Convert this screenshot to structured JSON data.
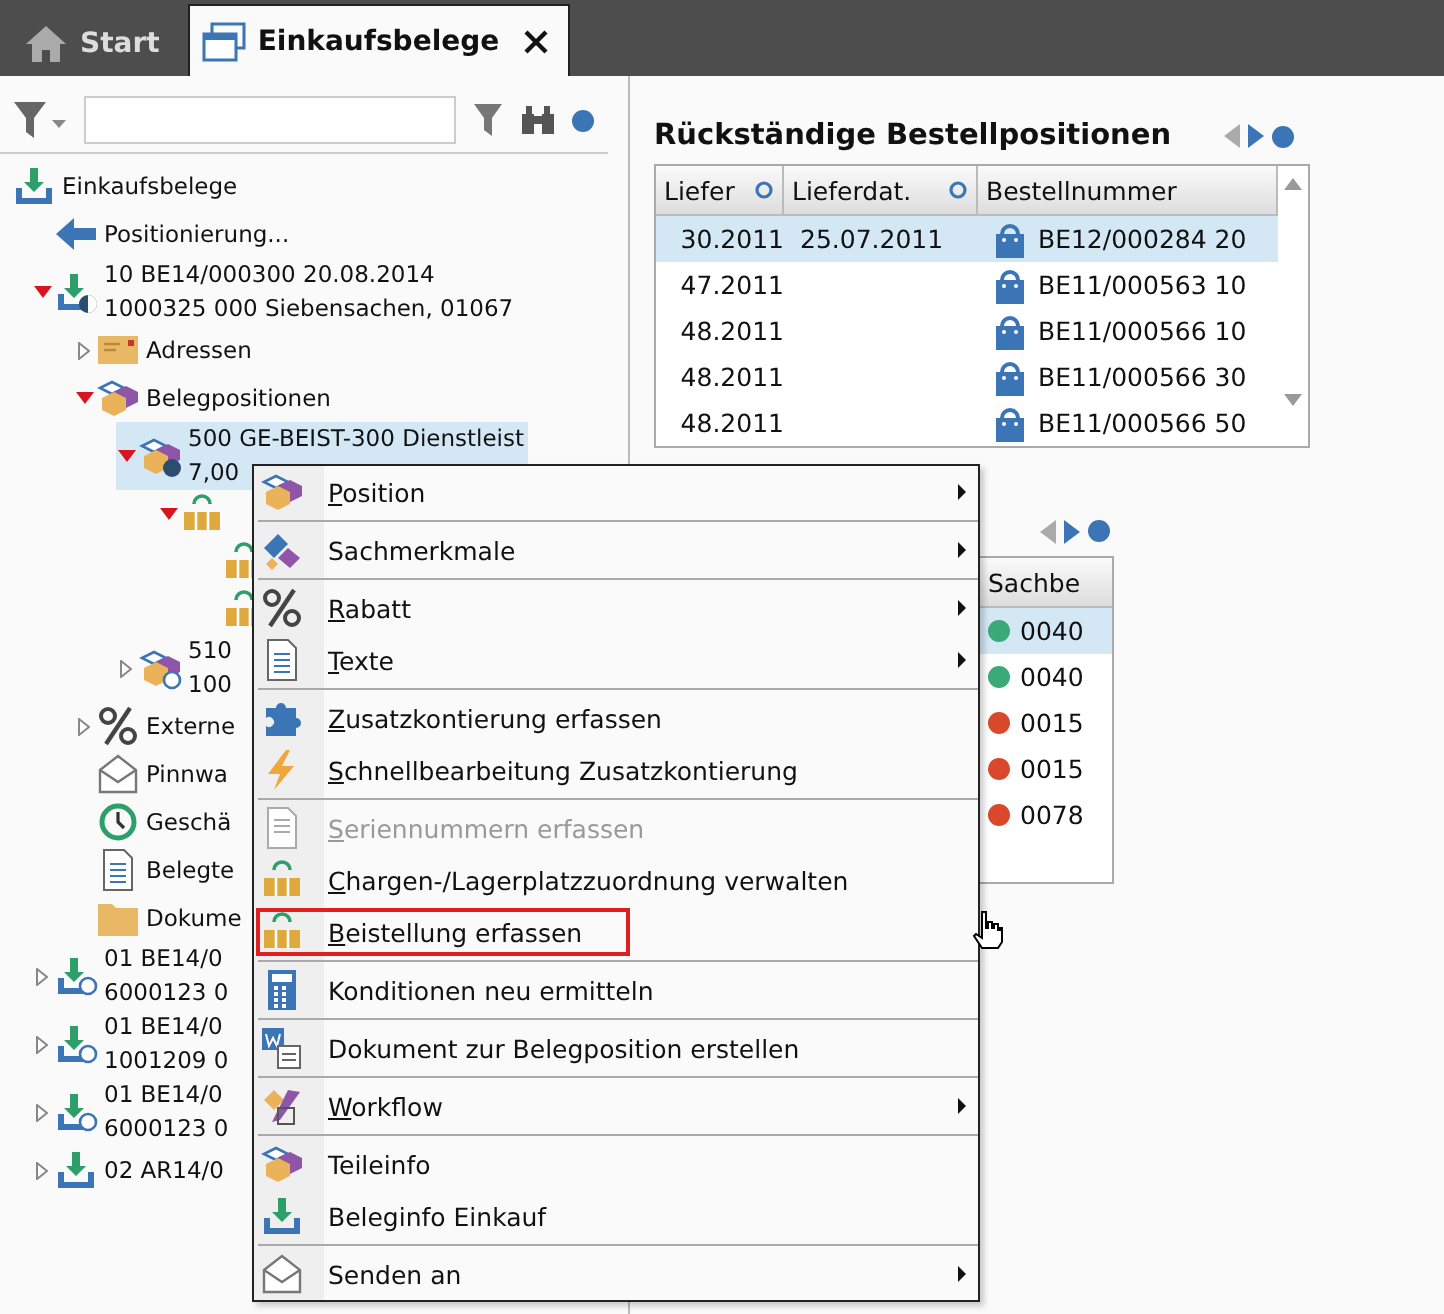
{
  "tabs": [
    {
      "label": "Start",
      "kind": "home",
      "selected": false,
      "closable": false
    },
    {
      "label": "Einkaufsbelege",
      "kind": "window",
      "selected": true,
      "closable": true
    }
  ],
  "tree": [
    {
      "kind": "inbox",
      "lines": [
        "Einkaufsbelege"
      ],
      "children": [
        {
          "kind": "arrow",
          "lines": [
            "Positionierung..."
          ]
        },
        {
          "kind": "inbox-half",
          "expanded": true,
          "lines": [
            "10 BE14/000300 20.08.2014",
            "1000325 000 Siebensachen, 01067"
          ],
          "children": [
            {
              "kind": "address",
              "expanded": false,
              "lines": [
                "Adressen"
              ]
            },
            {
              "kind": "boxes",
              "expanded": true,
              "lines": [
                "Belegpositionen"
              ],
              "children": [
                {
                  "kind": "boxes-dark",
                  "expanded": true,
                  "selected": true,
                  "lines": [
                    "500 GE-BEIST-300 Dienstleist",
                    "7,00"
                  ],
                  "children": [
                    {
                      "kind": "supply",
                      "expanded": true,
                      "children": [
                        {
                          "kind": "supply"
                        },
                        {
                          "kind": "supply"
                        }
                      ]
                    }
                  ]
                },
                {
                  "kind": "boxes-ring",
                  "expanded": false,
                  "selected": false,
                  "lines": [
                    "510",
                    "100"
                  ]
                }
              ]
            },
            {
              "kind": "percent",
              "expanded": false,
              "lines": [
                "Externe"
              ]
            },
            {
              "kind": "mail",
              "lines": [
                "Pinnwa"
              ]
            },
            {
              "kind": "history",
              "lines": [
                "Geschä"
              ]
            },
            {
              "kind": "text",
              "lines": [
                "Belegte"
              ]
            },
            {
              "kind": "folder",
              "lines": [
                "Dokume"
              ]
            }
          ]
        },
        {
          "kind": "inbox-ring",
          "expanded": false,
          "lines": [
            "01 BE14/0",
            "6000123 0"
          ]
        },
        {
          "kind": "inbox-ring",
          "expanded": false,
          "lines": [
            "01 BE14/0",
            "1001209 0"
          ]
        },
        {
          "kind": "inbox-ring",
          "expanded": false,
          "lines": [
            "01 BE14/0",
            "6000123 0"
          ]
        },
        {
          "kind": "inbox",
          "expanded": false,
          "lines": [
            "02 AR14/0"
          ]
        }
      ]
    }
  ],
  "backlog": {
    "title": "Rückständige Bestellpositionen",
    "columns": [
      "Liefer",
      "Lieferdat.",
      "Bestellnummer"
    ],
    "rows": [
      {
        "selected": true,
        "cells": [
          "30.2011",
          "25.07.2011",
          "BE12/000284 20"
        ]
      },
      {
        "selected": false,
        "cells": [
          "47.2011",
          "",
          "BE11/000563 10"
        ]
      },
      {
        "selected": false,
        "cells": [
          "48.2011",
          "",
          "BE11/000566 10"
        ]
      },
      {
        "selected": false,
        "cells": [
          "48.2011",
          "",
          "BE11/000566 30"
        ]
      },
      {
        "selected": false,
        "cells": [
          "48.2011",
          "",
          "BE11/000566 50"
        ]
      }
    ]
  },
  "second_panel": {
    "columns": [
      "Sachbe"
    ],
    "rows": [
      {
        "selected": true,
        "color": "#3aaa78",
        "value": "0040"
      },
      {
        "selected": false,
        "color": "#3aaa78",
        "value": "0040"
      },
      {
        "selected": false,
        "color": "#d9482b",
        "value": "0015"
      },
      {
        "selected": false,
        "color": "#d9482b",
        "value": "0015"
      },
      {
        "selected": false,
        "color": "#d9482b",
        "value": "0078"
      }
    ]
  },
  "context_menu": [
    {
      "kind": "boxes",
      "label": "Position",
      "mnemonic": true,
      "submenu": true,
      "disabled": false,
      "selected": false,
      "separator_before": false
    },
    {
      "kind": "tag",
      "label": "Sachmerkmale",
      "mnemonic": false,
      "submenu": true,
      "disabled": false,
      "selected": false,
      "separator_before": true
    },
    {
      "kind": "percent",
      "label": "Rabatt",
      "mnemonic": true,
      "submenu": true,
      "disabled": false,
      "selected": false,
      "separator_before": true
    },
    {
      "kind": "text",
      "label": "Texte",
      "mnemonic": true,
      "submenu": true,
      "disabled": false,
      "selected": false,
      "separator_before": false
    },
    {
      "kind": "puzzle",
      "label": "Zusatzkontierung erfassen",
      "mnemonic": true,
      "submenu": false,
      "disabled": false,
      "selected": false,
      "separator_before": true
    },
    {
      "kind": "bolt",
      "label": "Schnellbearbeitung Zusatzkontierung",
      "mnemonic": true,
      "submenu": false,
      "disabled": false,
      "selected": false,
      "separator_before": false
    },
    {
      "kind": "serial",
      "label": "Seriennummern erfassen",
      "mnemonic": true,
      "submenu": false,
      "disabled": true,
      "selected": false,
      "separator_before": true
    },
    {
      "kind": "supply",
      "label": "Chargen-/Lagerplatzzuordnung verwalten",
      "mnemonic": true,
      "submenu": false,
      "disabled": false,
      "selected": false,
      "separator_before": false
    },
    {
      "kind": "supply",
      "label": "Beistellung erfassen",
      "mnemonic": true,
      "submenu": false,
      "disabled": false,
      "selected": true,
      "separator_before": false
    },
    {
      "kind": "calculator",
      "label": "Konditionen neu ermitteln",
      "mnemonic": false,
      "submenu": false,
      "disabled": false,
      "selected": false,
      "separator_before": true
    },
    {
      "kind": "word",
      "label": "Dokument zur Belegposition erstellen",
      "mnemonic": false,
      "submenu": false,
      "disabled": false,
      "selected": false,
      "separator_before": true
    },
    {
      "kind": "workflow",
      "label": "Workflow",
      "mnemonic": true,
      "submenu": true,
      "disabled": false,
      "selected": false,
      "separator_before": true
    },
    {
      "kind": "boxes",
      "label": "Teileinfo",
      "mnemonic": false,
      "submenu": false,
      "disabled": false,
      "selected": false,
      "separator_before": true
    },
    {
      "kind": "inbox",
      "label": "Beleginfo Einkauf",
      "mnemonic": false,
      "submenu": false,
      "disabled": false,
      "selected": false,
      "separator_before": false
    },
    {
      "kind": "mail",
      "label": "Senden an",
      "mnemonic": false,
      "submenu": true,
      "disabled": false,
      "selected": false,
      "separator_before": true
    }
  ]
}
